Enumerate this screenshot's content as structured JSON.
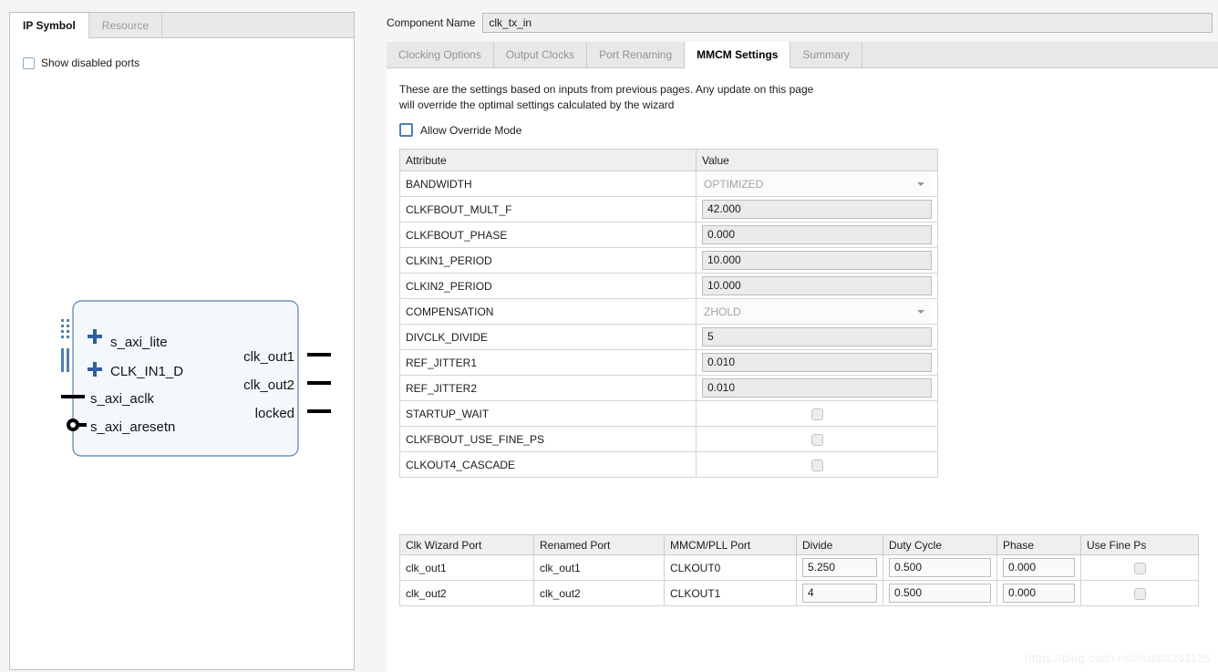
{
  "left_panel": {
    "tabs": [
      {
        "label": "IP Symbol",
        "active": true
      },
      {
        "label": "Resource",
        "active": false
      }
    ],
    "show_disabled_ports_label": "Show disabled ports",
    "show_disabled_ports_checked": false,
    "symbol": {
      "left_ports": [
        {
          "label": "s_axi_lite",
          "type": "bus"
        },
        {
          "label": "CLK_IN1_D",
          "type": "bus"
        },
        {
          "label": "s_axi_aclk",
          "type": "clock"
        },
        {
          "label": "s_axi_aresetn",
          "type": "reset-low"
        }
      ],
      "right_ports": [
        {
          "label": "clk_out1"
        },
        {
          "label": "clk_out2"
        },
        {
          "label": "locked"
        }
      ],
      "body_fill": "#f4f8fd",
      "body_stroke": "#5a7fad"
    }
  },
  "header": {
    "component_name_label": "Component Name",
    "component_name_value": "clk_tx_in"
  },
  "tabs": [
    {
      "label": "Clocking Options",
      "active": false
    },
    {
      "label": "Output Clocks",
      "active": false
    },
    {
      "label": "Port Renaming",
      "active": false
    },
    {
      "label": "MMCM Settings",
      "active": true
    },
    {
      "label": "Summary",
      "active": false
    }
  ],
  "description": {
    "line1": "These are the settings based on inputs from previous pages. Any update on this page",
    "line2": "will override the optimal settings calculated by the wizard"
  },
  "allow_override": {
    "label": "Allow Override Mode",
    "checked": false
  },
  "attribute_table": {
    "headers": [
      "Attribute",
      "Value"
    ],
    "rows": [
      {
        "attribute": "BANDWIDTH",
        "value": "OPTIMIZED",
        "kind": "combo"
      },
      {
        "attribute": "CLKFBOUT_MULT_F",
        "value": "42.000",
        "kind": "field"
      },
      {
        "attribute": "CLKFBOUT_PHASE",
        "value": "0.000",
        "kind": "field"
      },
      {
        "attribute": "CLKIN1_PERIOD",
        "value": "10.000",
        "kind": "field"
      },
      {
        "attribute": "CLKIN2_PERIOD",
        "value": "10.000",
        "kind": "field"
      },
      {
        "attribute": "COMPENSATION",
        "value": "ZHOLD",
        "kind": "combo"
      },
      {
        "attribute": "DIVCLK_DIVIDE",
        "value": "5",
        "kind": "field"
      },
      {
        "attribute": "REF_JITTER1",
        "value": "0.010",
        "kind": "field"
      },
      {
        "attribute": "REF_JITTER2",
        "value": "0.010",
        "kind": "field"
      },
      {
        "attribute": "STARTUP_WAIT",
        "value": "",
        "kind": "checkbox",
        "checked": false
      },
      {
        "attribute": "CLKFBOUT_USE_FINE_PS",
        "value": "",
        "kind": "checkbox",
        "checked": false
      },
      {
        "attribute": "CLKOUT4_CASCADE",
        "value": "",
        "kind": "checkbox",
        "checked": false
      }
    ]
  },
  "clock_table": {
    "headers": [
      "Clk Wizard Port",
      "Renamed Port",
      "MMCM/PLL Port",
      "Divide",
      "Duty Cycle",
      "Phase",
      "Use Fine Ps"
    ],
    "rows": [
      {
        "clk_wizard_port": "clk_out1",
        "renamed_port": "clk_out1",
        "mmcm_pll_port": "CLKOUT0",
        "divide": "5.250",
        "duty_cycle": "0.500",
        "phase": "0.000",
        "use_fine_ps": false
      },
      {
        "clk_wizard_port": "clk_out2",
        "renamed_port": "clk_out2",
        "mmcm_pll_port": "CLKOUT1",
        "divide": "4",
        "duty_cycle": "0.500",
        "phase": "0.000",
        "use_fine_ps": false
      }
    ]
  },
  "watermark": "https://blog.csdn.net/liu583261126"
}
